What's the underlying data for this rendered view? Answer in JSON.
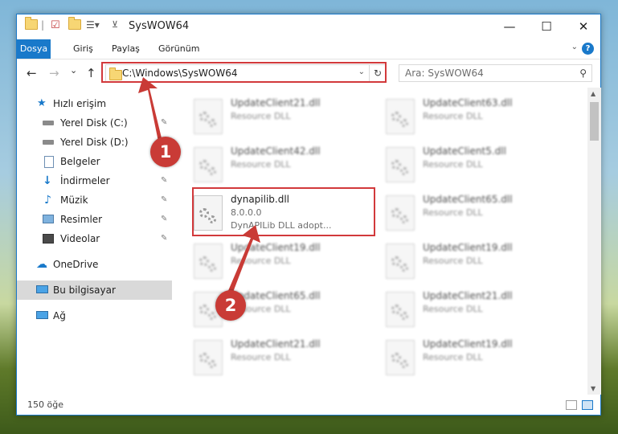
{
  "window": {
    "title": "SysWOW64",
    "minimize": "—",
    "maximize": "☐",
    "close": "✕"
  },
  "ribbon": {
    "tabs": [
      "Dosya",
      "Giriş",
      "Paylaş",
      "Görünüm"
    ],
    "help": "?"
  },
  "nav": {
    "back": "←",
    "forward": "→",
    "recent": "⌄",
    "up": "↑"
  },
  "address": {
    "path": "C:\\Windows\\SysWOW64",
    "refresh": "↻",
    "dropdown": "⌄"
  },
  "search": {
    "placeholder": "Ara: SysWOW64"
  },
  "sidebar": {
    "items": [
      {
        "label": "Hızlı erişim",
        "icon": "star-icon"
      },
      {
        "label": "Yerel Disk (C:)",
        "icon": "drive-icon",
        "pinned": true
      },
      {
        "label": "Yerel Disk (D:)",
        "icon": "drive-icon"
      },
      {
        "label": "Belgeler",
        "icon": "documents-icon"
      },
      {
        "label": "İndirmeler",
        "icon": "download-icon",
        "pinned": true
      },
      {
        "label": "Müzik",
        "icon": "music-icon",
        "pinned": true
      },
      {
        "label": "Resimler",
        "icon": "pictures-icon",
        "pinned": true
      },
      {
        "label": "Videolar",
        "icon": "videos-icon",
        "pinned": true
      },
      {
        "label": "OneDrive",
        "icon": "cloud-icon"
      },
      {
        "label": "Bu bilgisayar",
        "icon": "computer-icon",
        "selected": true
      },
      {
        "label": "Ağ",
        "icon": "network-icon"
      }
    ],
    "pin_glyph": "📌"
  },
  "files": {
    "left": [
      {
        "name": "UpdateClient21.dll",
        "type": "Resource DLL"
      },
      {
        "name": "UpdateClient42.dll",
        "type": "Resource DLL"
      },
      {
        "name": "dynapilib.dll",
        "version": "8.0.0.0",
        "desc": "DynAPILib DLL adopt..."
      },
      {
        "name": "UpdateClient19.dll",
        "type": "Resource DLL"
      },
      {
        "name": "UpdateClient65.dll",
        "type": "Resource DLL"
      },
      {
        "name": "UpdateClient21.dll",
        "type": "Resource DLL"
      }
    ],
    "right": [
      {
        "name": "UpdateClient63.dll",
        "type": "Resource DLL"
      },
      {
        "name": "UpdateClient5.dll",
        "type": "Resource DLL"
      },
      {
        "name": "UpdateClient65.dll",
        "type": "Resource DLL"
      },
      {
        "name": "UpdateClient19.dll",
        "type": "Resource DLL"
      },
      {
        "name": "UpdateClient21.dll",
        "type": "Resource DLL"
      },
      {
        "name": "UpdateClient19.dll",
        "type": "Resource DLL"
      }
    ]
  },
  "status": {
    "count": "150 öğe"
  },
  "annotations": {
    "step1": "1",
    "step2": "2"
  },
  "colors": {
    "accent": "#1979ca",
    "highlight": "#d2393b"
  }
}
